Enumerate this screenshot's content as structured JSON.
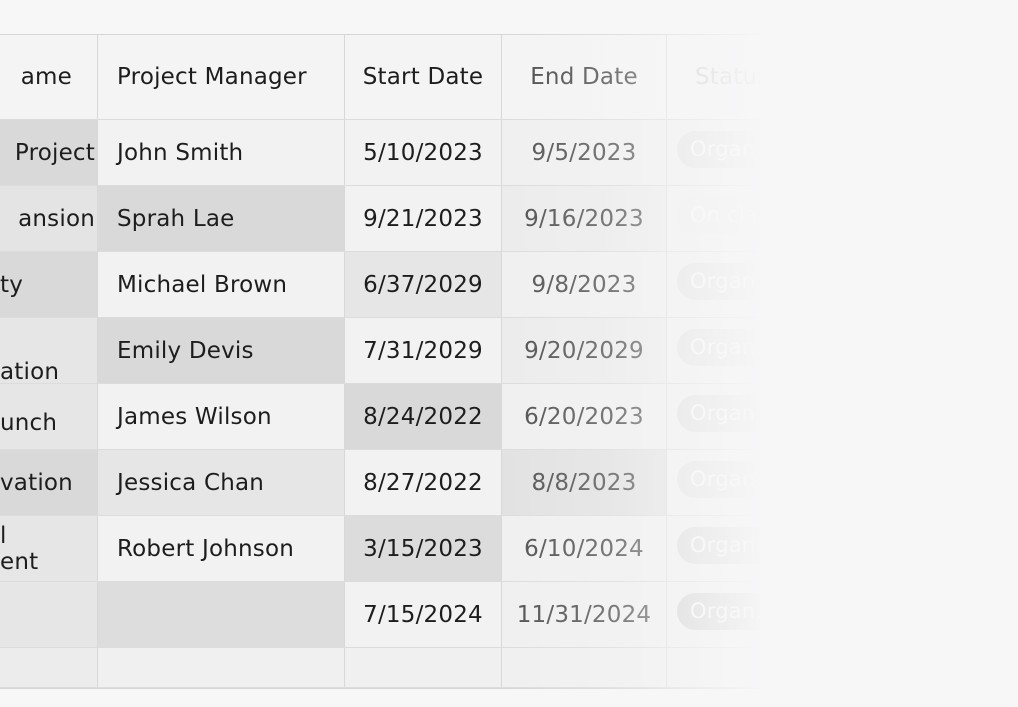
{
  "table": {
    "headers": {
      "name": "ame",
      "project_manager": "Project Manager",
      "start_date": "Start Date",
      "end_date": "End Date",
      "status": "Status"
    },
    "rows": [
      {
        "name": "Project",
        "pm": "John Smith",
        "start": "5/10/2023",
        "end": "9/5/2023",
        "status": "Organ..."
      },
      {
        "name": "ansion",
        "pm": "Sprah Lae",
        "start": "9/21/2023",
        "end": "9/16/2023",
        "status": "On clari"
      },
      {
        "name": "ty",
        "pm": "Michael Brown",
        "start": "6/37/2029",
        "end": "9/8/2023",
        "status": "Organ..."
      },
      {
        "name": "ation",
        "pm": "Emily Devis",
        "start": "7/31/2029",
        "end": "9/20/2029",
        "status": "Organ..."
      },
      {
        "name": "unch",
        "pm": "James Wilson",
        "start": "8/24/2022",
        "end": "6/20/2023",
        "status": "Organ..."
      },
      {
        "name": "vation",
        "pm": "Jessica Chan",
        "start": "8/27/2022",
        "end": "8/8/2023",
        "status": "Organ..."
      },
      {
        "name": "l\nent",
        "pm": "Robert Johnson",
        "start": "3/15/2023",
        "end": "6/10/2024",
        "status": "Organ..."
      },
      {
        "name": "",
        "pm": "",
        "start": "7/15/2024",
        "end": "11/31/2024",
        "status": "Organ..."
      }
    ]
  },
  "colors": {
    "header_bg": "#f4f4f4",
    "cell_light": "#f2f2f2",
    "cell_mid": "#e6e6e6",
    "cell_dark": "#d9d9d9",
    "pill_bg": "#d0d0d0"
  }
}
